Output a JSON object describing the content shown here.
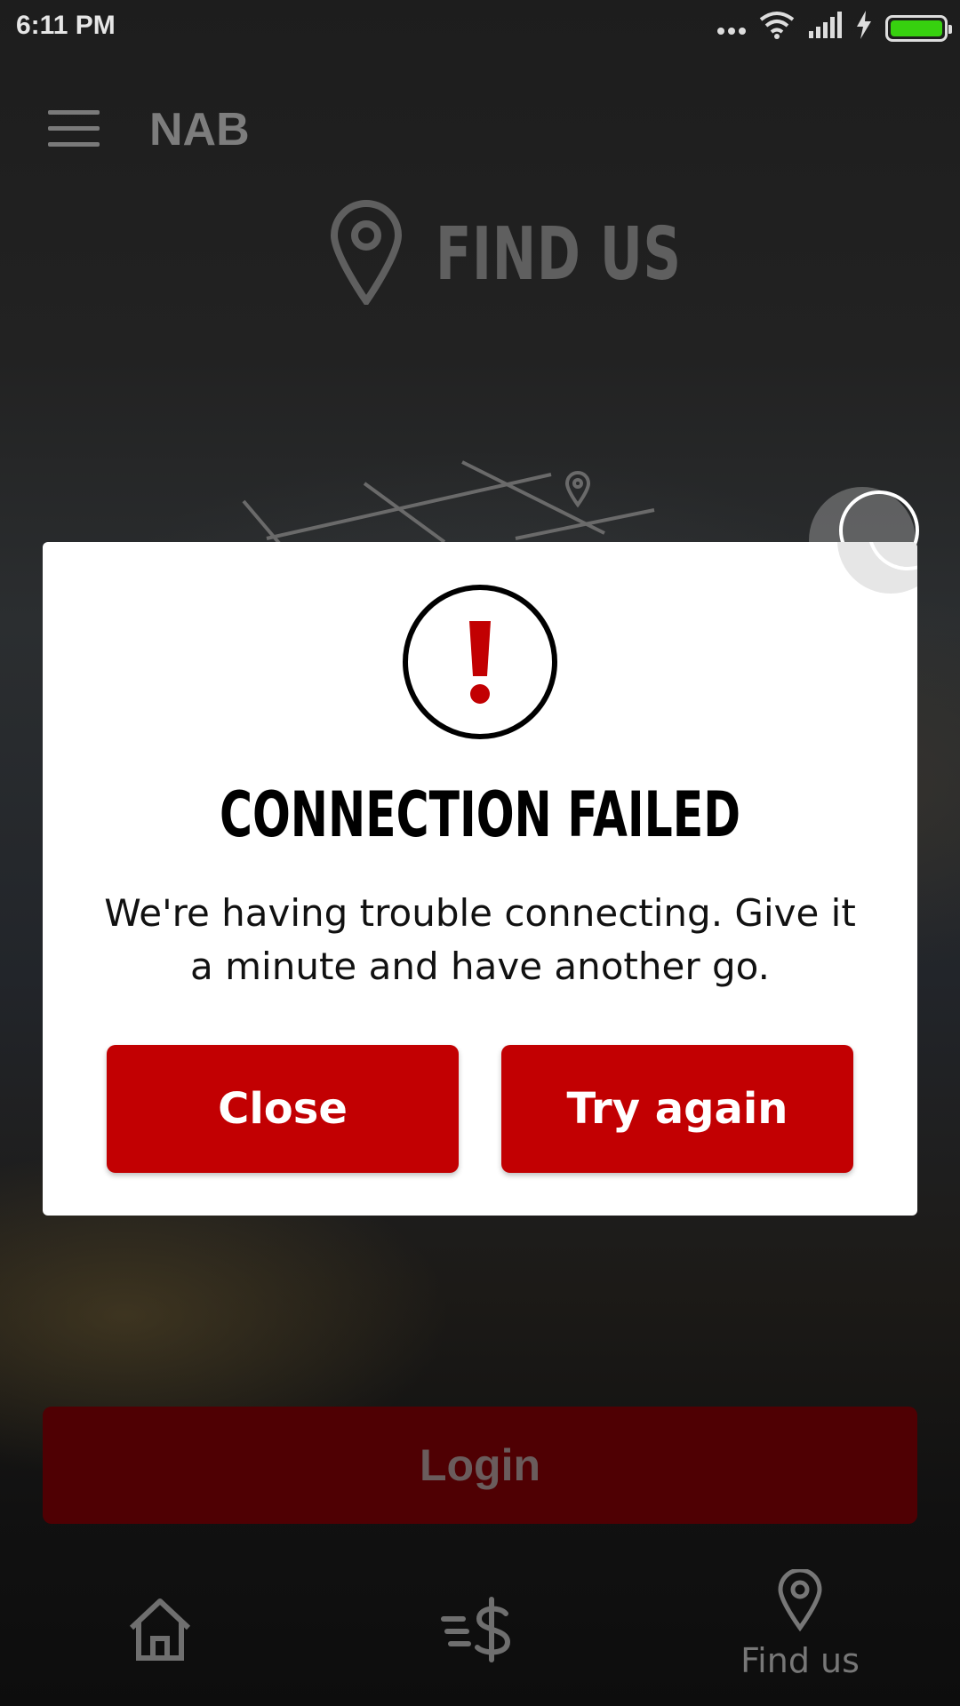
{
  "status_bar": {
    "time": "6:11 PM",
    "icons": [
      "more-dots-icon",
      "wifi-icon",
      "signal-icon",
      "charging-bolt-icon",
      "battery-icon"
    ],
    "battery_color": "#37d10f"
  },
  "app_header": {
    "brand": "NAB",
    "page_title": "FIND US",
    "page_icon": "location-pin-icon"
  },
  "login_button": {
    "label": "Login"
  },
  "bottom_nav": {
    "items": [
      {
        "icon": "home-icon",
        "label": ""
      },
      {
        "icon": "payments-icon",
        "label": ""
      },
      {
        "icon": "location-pin-icon",
        "label": "Find us"
      }
    ]
  },
  "dialog": {
    "icon": "alert-exclamation-icon",
    "title": "CONNECTION FAILED",
    "message": "We're having trouble connecting. Give it a minute and have another go.",
    "close_label": "Close",
    "retry_label": "Try again",
    "accent_color": "#c20002"
  }
}
